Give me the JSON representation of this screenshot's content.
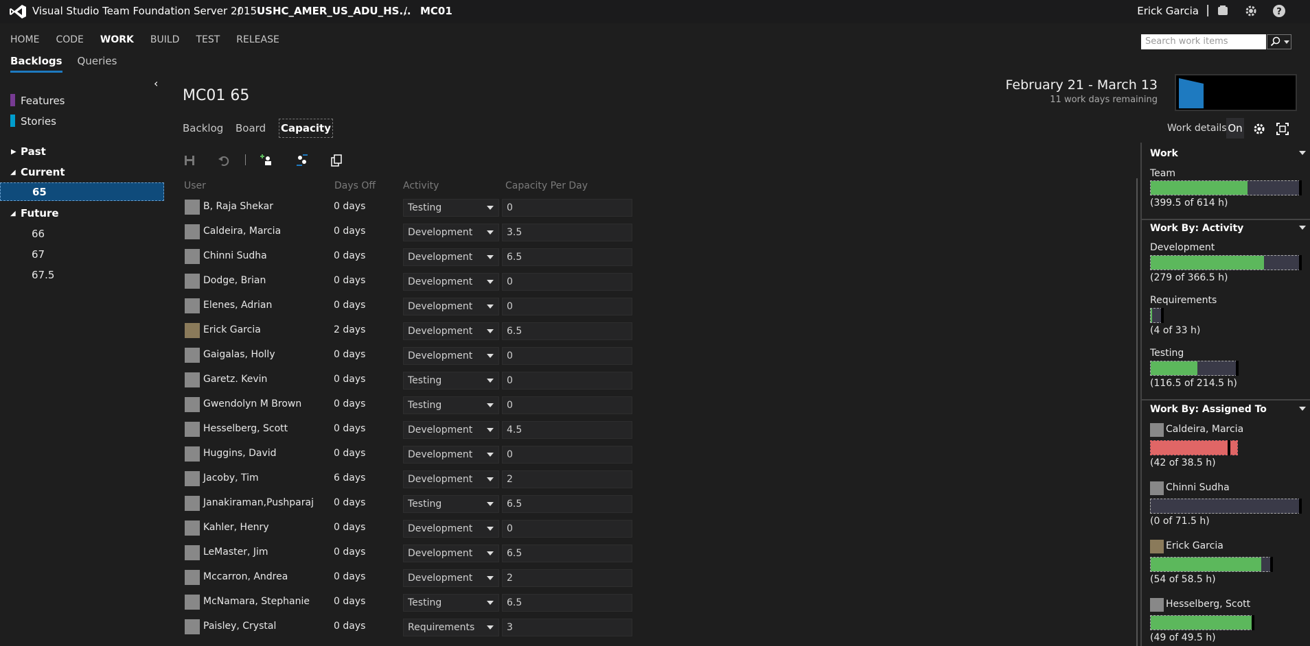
{
  "header": {
    "product": "Visual Studio Team Foundation Server 2015",
    "separator": "/",
    "collection": "USHC_AMER_US_ADU_HS...",
    "project": "MC01",
    "user": "Erick Garcia",
    "user_separator": "|"
  },
  "hubs": [
    "HOME",
    "CODE",
    "WORK",
    "BUILD",
    "TEST",
    "RELEASE"
  ],
  "active_hub": "WORK",
  "pivots": [
    "Backlogs",
    "Queries"
  ],
  "search": {
    "placeholder": "Search work items"
  },
  "backlog_nav": {
    "features": "Features",
    "stories": "Stories",
    "past": "Past",
    "current": "Current",
    "current_sprint": "65",
    "future": "Future",
    "future_sprints": [
      "66",
      "67",
      "67.5"
    ],
    "features_color": "#773b93",
    "stories_color": "#009ccc"
  },
  "sprint": {
    "title": "MC01 65",
    "tabs": [
      "Backlog",
      "Board",
      "Capacity"
    ],
    "date_range": "February 21 - March 13",
    "days_remaining": "11 work days remaining",
    "burndown_fill": 0.3
  },
  "work_details": {
    "label": "Work details",
    "state": "On"
  },
  "capacity_table": {
    "headers": [
      "User",
      "Days Off",
      "Activity",
      "Capacity Per Day"
    ],
    "rows": [
      {
        "user": "B, Raja Shekar",
        "days_off": "0 days",
        "activity": "Testing",
        "capacity": "0"
      },
      {
        "user": "Caldeira, Marcia",
        "days_off": "0 days",
        "activity": "Development",
        "capacity": "3.5"
      },
      {
        "user": "Chinni Sudha",
        "days_off": "0 days",
        "activity": "Development",
        "capacity": "6.5"
      },
      {
        "user": "Dodge, Brian",
        "days_off": "0 days",
        "activity": "Development",
        "capacity": "0"
      },
      {
        "user": "Elenes, Adrian",
        "days_off": "0 days",
        "activity": "Development",
        "capacity": "0"
      },
      {
        "user": "Erick Garcia",
        "days_off": "2 days",
        "activity": "Development",
        "capacity": "6.5"
      },
      {
        "user": "Gaigalas, Holly",
        "days_off": "0 days",
        "activity": "Development",
        "capacity": "0"
      },
      {
        "user": "Garetz. Kevin",
        "days_off": "0 days",
        "activity": "Testing",
        "capacity": "0"
      },
      {
        "user": "Gwendolyn M Brown",
        "days_off": "0 days",
        "activity": "Testing",
        "capacity": "0"
      },
      {
        "user": "Hesselberg, Scott",
        "days_off": "0 days",
        "activity": "Development",
        "capacity": "4.5"
      },
      {
        "user": "Huggins, David",
        "days_off": "0 days",
        "activity": "Development",
        "capacity": "0"
      },
      {
        "user": "Jacoby, Tim",
        "days_off": "6 days",
        "activity": "Development",
        "capacity": "2"
      },
      {
        "user": "Janakiraman,Pushparaj",
        "days_off": "0 days",
        "activity": "Testing",
        "capacity": "6.5"
      },
      {
        "user": "Kahler, Henry",
        "days_off": "0 days",
        "activity": "Development",
        "capacity": "0"
      },
      {
        "user": "LeMaster, Jim",
        "days_off": "0 days",
        "activity": "Development",
        "capacity": "6.5"
      },
      {
        "user": "Mccarron, Andrea",
        "days_off": "0 days",
        "activity": "Development",
        "capacity": "2"
      },
      {
        "user": "McNamara, Stephanie",
        "days_off": "0 days",
        "activity": "Testing",
        "capacity": "6.5"
      },
      {
        "user": "Paisley, Crystal",
        "days_off": "0 days",
        "activity": "Requirements",
        "capacity": "3"
      }
    ]
  },
  "work_panel": {
    "work_header": "Work",
    "team_label": "Team",
    "team_value": "(399.5 of 614 h)",
    "team_fill": 0.65,
    "activity_header": "Work By: Activity",
    "activities": [
      {
        "name": "Development",
        "value": "(279 of 366.5 h)",
        "fill": 0.76
      },
      {
        "name": "Requirements",
        "value": "(4 of 33 h)",
        "fill": 0.12
      },
      {
        "name": "Testing",
        "value": "(116.5 of 214.5 h)",
        "fill": 0.54
      }
    ],
    "assigned_header": "Work By: Assigned To",
    "assigned": [
      {
        "name": "Caldeira, Marcia",
        "value": "(42 of 38.5 h)",
        "fill": 1.0
      },
      {
        "name": "Chinni Sudha",
        "value": "(0 of 71.5 h)",
        "fill": 0.0
      },
      {
        "name": "Erick Garcia",
        "value": "(54 of 58.5 h)",
        "fill": 0.92
      },
      {
        "name": "Hesselberg, Scott",
        "value": "(49 of 49.5 h)",
        "fill": 0.99
      }
    ]
  },
  "colors": {
    "accent": "#1e7ac0",
    "under_capacity": "#5cb85c",
    "over_capacity": "#e06666",
    "burndown": "#1e7ac0"
  }
}
